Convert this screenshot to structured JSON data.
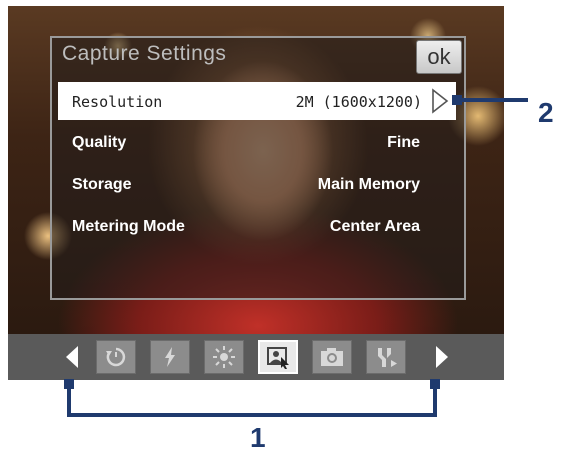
{
  "panel": {
    "title": "Capture Settings",
    "ok_label": "ok",
    "rows": [
      {
        "label": "Resolution",
        "value": "2M (1600x1200)"
      },
      {
        "label": "Quality",
        "value": "Fine"
      },
      {
        "label": "Storage",
        "value": "Main Memory"
      },
      {
        "label": "Metering Mode",
        "value": "Center Area"
      }
    ]
  },
  "toolbar": {
    "icons": [
      "self-timer-icon",
      "flash-icon",
      "brightness-icon",
      "settings-icon",
      "capture-mode-icon",
      "advanced-tools-icon"
    ]
  },
  "callouts": {
    "one": "1",
    "two": "2"
  },
  "colors": {
    "annotation": "#1f3a6e",
    "toolbar": "#5a5a5a",
    "selected_row": "#ffffff"
  }
}
